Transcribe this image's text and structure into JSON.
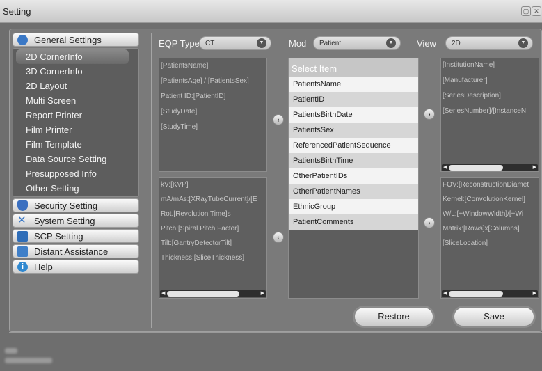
{
  "window": {
    "title": "Setting"
  },
  "sidebar": {
    "categories": [
      {
        "label": "General Settings",
        "icon": "list-circle-icon",
        "color": "#3a78c6"
      },
      {
        "label": "Security Setting",
        "icon": "shield-icon",
        "color": "#3a6fc0"
      },
      {
        "label": "System Setting",
        "icon": "tools-icon",
        "color": "#3a78c6"
      },
      {
        "label": "SCP Setting",
        "icon": "monitor-icon",
        "color": "#2e6db8"
      },
      {
        "label": "Distant Assistance",
        "icon": "network-icon",
        "color": "#3f7fc8"
      },
      {
        "label": "Help",
        "icon": "info-icon",
        "color": "#2f88d0"
      }
    ],
    "general_items": [
      "2D CornerInfo",
      "3D CornerInfo",
      "2D Layout",
      "Multi Screen",
      "Report Printer",
      "Film Printer",
      "Film Template",
      "Data Source Setting",
      "Presupposed Info",
      "Other Setting"
    ],
    "active_item": "2D CornerInfo"
  },
  "filters": {
    "eqp_label": "EQP Type",
    "eqp_value": "CT",
    "mod_label": "Mod",
    "mod_value": "Patient",
    "view_label": "View",
    "view_value": "2D"
  },
  "left_top_lines": [
    "[PatientsName]",
    "[PatientsAge] / [PatientsSex]",
    "Patient ID:[PatientID]",
    "[StudyDate]",
    "[StudyTime]"
  ],
  "left_bottom_lines": [
    "kV:[KVP]",
    "mA/mAs:[XRayTubeCurrent]/[E",
    "Rot.[Revolution Time]s",
    "Pitch:[Spiral Pitch Factor]",
    "Tilt:[GantryDetectorTilt]",
    "Thickness:[SliceThickness]"
  ],
  "right_top_lines": [
    "[InstitutionName]",
    "[Manufacturer]",
    "[SeriesDescription]",
    "[SeriesNumber]/[InstanceN"
  ],
  "right_bottom_lines": [
    "FOV:[ReconstructionDiamet",
    "Kernel:[ConvolutionKernel]",
    "W/L:[+WindowWidth]/[+Wi",
    "Matrix:[Rows]x[Columns]",
    "[SliceLocation]"
  ],
  "select_list": {
    "header": "Select Item",
    "items": [
      "PatientsName",
      "PatientID",
      "PatientsBirthDate",
      "PatientsSex",
      "ReferencedPatientSequence",
      "PatientsBirthTime",
      "OtherPatientIDs",
      "OtherPatientNames",
      "EthnicGroup",
      "PatientComments"
    ]
  },
  "buttons": {
    "restore": "Restore",
    "save": "Save"
  }
}
